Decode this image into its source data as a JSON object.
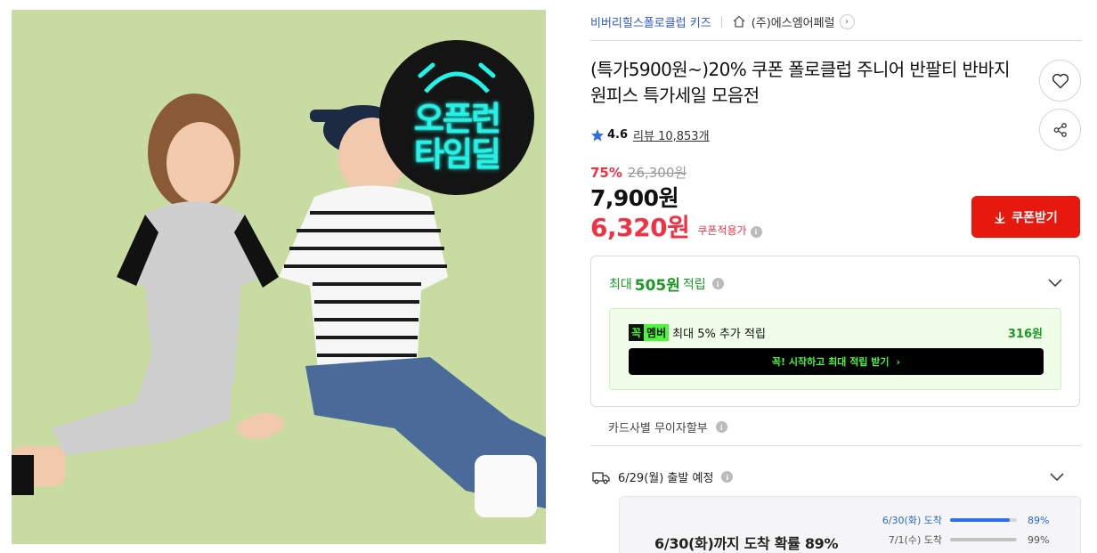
{
  "breadcrumb": {
    "brand": "비버리힐스폴로클럽 키즈",
    "seller": "(주)에스엠어페럴"
  },
  "timedeal_badge": {
    "line1": "오픈런",
    "line2": "타임딜"
  },
  "title": "(특가5900원~)20% 쿠폰 폴로클럽 주니어 반팔티 반바지 원피스 특가세일 모음전",
  "rating": {
    "score": "4.6",
    "review_label": "리뷰 10,853개"
  },
  "price": {
    "discount_rate": "75%",
    "original": "26,300원",
    "sale": "7,900원",
    "coupon_price": "6,320원",
    "coupon_price_label": "쿠폰적용가"
  },
  "coupon_button": "쿠폰받기",
  "points": {
    "prefix": "최대",
    "amount": "505원",
    "suffix": "적립",
    "member_tag_1": "꼭",
    "member_tag_2": "멤버",
    "member_text": "최대 5% 추가 적립",
    "member_amount": "316원",
    "cta": "꼭! 시작하고 최대 적립 받기"
  },
  "installment": "카드사별 무이자할부",
  "shipping": {
    "departure": "6/29(월) 출발 예정",
    "headline": "6/30(화)까지 도착 확률 89%",
    "rows": [
      {
        "date": "6/30(화) 도착",
        "percent": "89%",
        "ratio": 0.89
      },
      {
        "date": "7/1(수) 도착",
        "percent": "99%",
        "ratio": 0.99
      }
    ]
  },
  "colors": {
    "accent_red": "#f43142",
    "button_red": "#e7180d",
    "brand_blue": "#2e59c7",
    "points_green": "#1a9a25",
    "member_neon": "#4df53d",
    "badge_cyan": "#23f2e6"
  },
  "icons": [
    "home-icon",
    "chevron-right-icon",
    "heart-icon",
    "share-icon",
    "star-icon",
    "info-icon",
    "download-icon",
    "chevron-down-icon",
    "truck-icon"
  ]
}
